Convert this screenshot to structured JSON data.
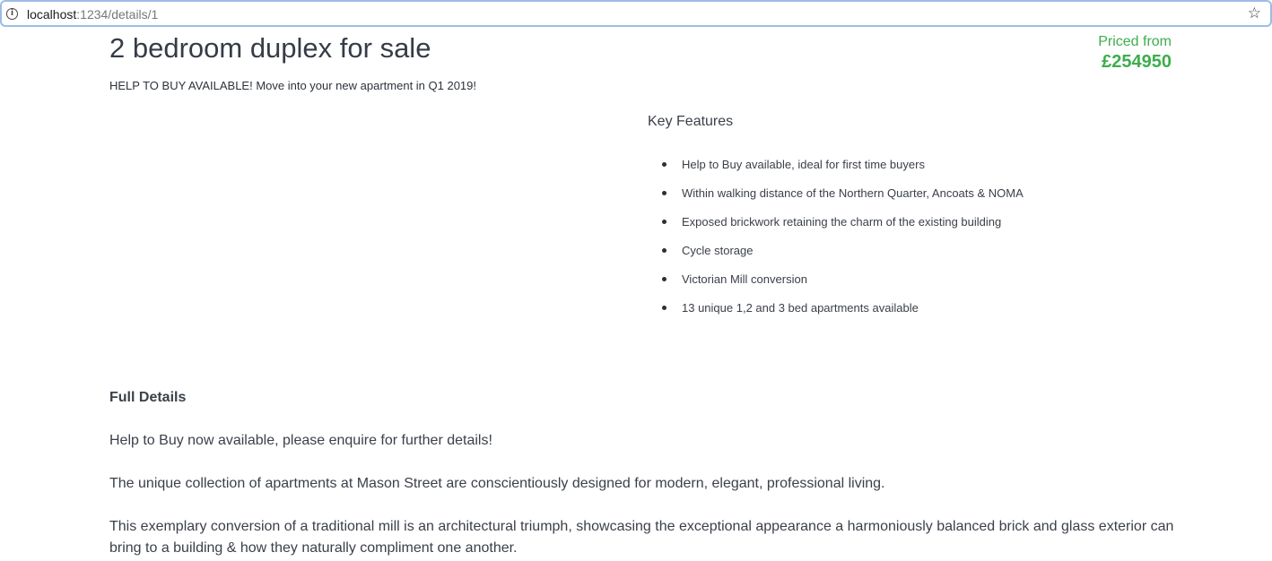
{
  "browser": {
    "url_host": "localhost",
    "url_path": ":1234/details/1",
    "info_icon": "info-icon",
    "bookmark_icon": "star-icon"
  },
  "listing": {
    "title": "2 bedroom duplex for sale",
    "subtitle": "HELP TO BUY AVAILABLE! Move into your new apartment in Q1 2019!",
    "price_label": "Priced from",
    "price_value": "£254950"
  },
  "key_features": {
    "heading": "Key Features",
    "items": [
      "Help to Buy available, ideal for first time buyers",
      "Within walking distance of the Northern Quarter, Ancoats & NOMA",
      "Exposed brickwork retaining the charm of the existing building",
      "Cycle storage",
      "Victorian Mill conversion",
      "13 unique 1,2 and 3 bed apartments available"
    ]
  },
  "full_details": {
    "heading": "Full Details",
    "paragraphs": [
      "Help to Buy now available, please enquire for further details!",
      "The unique collection of apartments at Mason Street are conscientiously designed for modern, elegant, professional living.",
      "This exemplary conversion of a traditional mill is an architectural triumph, showcasing the exceptional appearance a harmoniously balanced brick and glass exterior can bring to a building & how they naturally compliment one another."
    ]
  },
  "colors": {
    "price": "#3cae4c",
    "text": "#3b4049",
    "address_bar_border": "#9dbce8"
  }
}
